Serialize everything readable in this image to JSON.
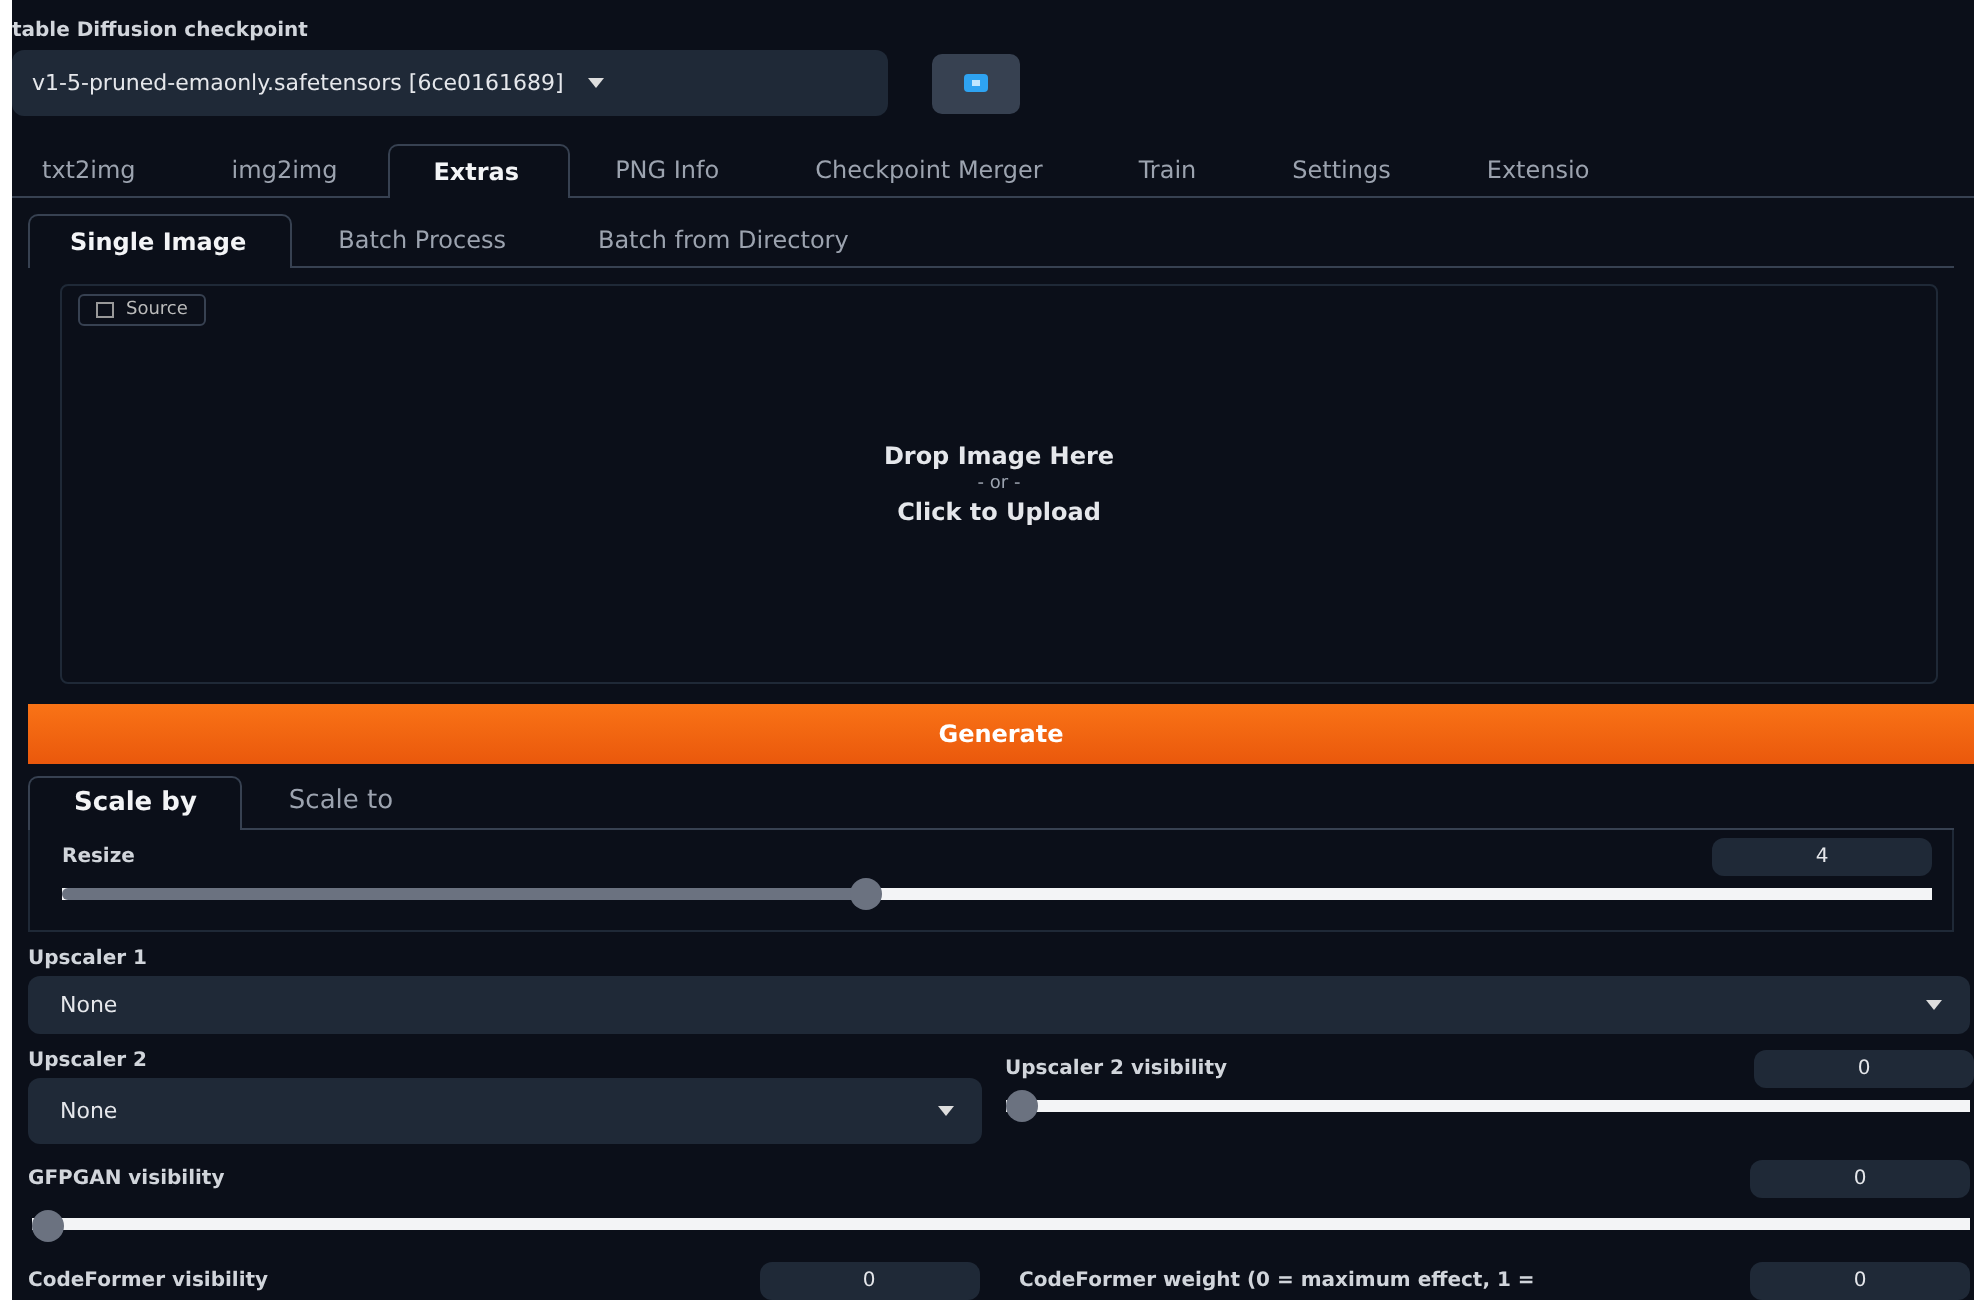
{
  "checkpoint": {
    "label": "table Diffusion checkpoint",
    "value": "v1-5-pruned-emaonly.safetensors [6ce0161689]"
  },
  "tabs": [
    {
      "label": "txt2img",
      "selected": false
    },
    {
      "label": "img2img",
      "selected": false
    },
    {
      "label": "Extras",
      "selected": true
    },
    {
      "label": "PNG Info",
      "selected": false
    },
    {
      "label": "Checkpoint Merger",
      "selected": false
    },
    {
      "label": "Train",
      "selected": false
    },
    {
      "label": "Settings",
      "selected": false
    },
    {
      "label": "Extensio",
      "selected": false
    }
  ],
  "subtabs": [
    {
      "label": "Single Image",
      "selected": true
    },
    {
      "label": "Batch Process",
      "selected": false
    },
    {
      "label": "Batch from Directory",
      "selected": false
    }
  ],
  "source": {
    "label": "Source",
    "drop_text": "Drop Image Here",
    "or_text": "- or -",
    "click_text": "Click to Upload"
  },
  "generate": "Generate",
  "scale_tabs": [
    {
      "label": "Scale by",
      "selected": true
    },
    {
      "label": "Scale to",
      "selected": false
    }
  ],
  "resize": {
    "label": "Resize",
    "value": "4",
    "level": 0.43
  },
  "upscaler1": {
    "label": "Upscaler 1",
    "value": "None"
  },
  "upscaler2": {
    "label": "Upscaler 2",
    "value": "None"
  },
  "upscaler2_visibility": {
    "label": "Upscaler 2 visibility",
    "value": "0",
    "level": 0
  },
  "gfpgan": {
    "label": "GFPGAN visibility",
    "value": "0",
    "level": 0
  },
  "codeformer_visibility": {
    "label": "CodeFormer visibility",
    "value": "0"
  },
  "codeformer_weight": {
    "label": "CodeFormer weight (0 = maximum effect, 1 =",
    "value": "0"
  }
}
